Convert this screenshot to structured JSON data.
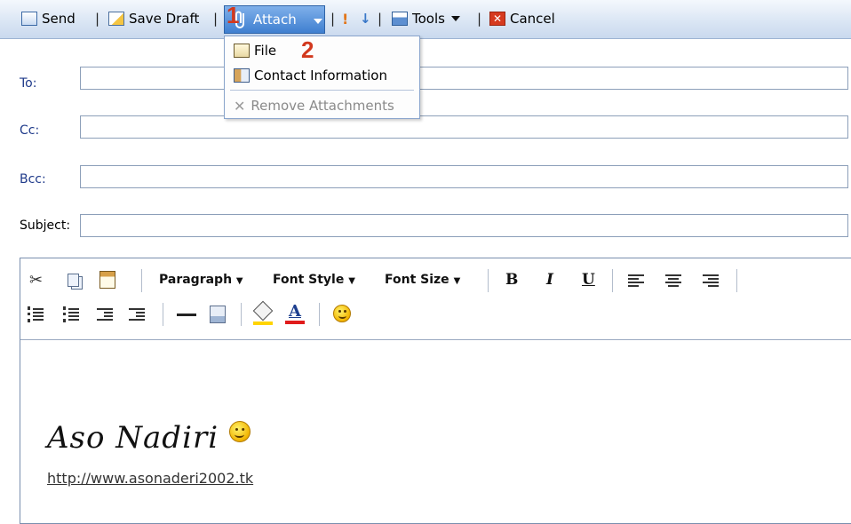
{
  "toolbar": {
    "send": "Send",
    "save_draft": "Save Draft",
    "attach": "Attach",
    "tools": "Tools",
    "cancel": "Cancel",
    "separator": "|",
    "step1": "1",
    "step2": "2"
  },
  "attach_menu": {
    "items": [
      {
        "label": "File",
        "icon": "file-icon",
        "enabled": true
      },
      {
        "label": "Contact Information",
        "icon": "contact-card-icon",
        "enabled": true
      },
      {
        "label": "Remove Attachments",
        "icon": "x-icon",
        "enabled": false
      }
    ]
  },
  "fields": {
    "to_label": "To:",
    "cc_label": "Cc:",
    "bcc_label": "Bcc:",
    "subject_label": "Subject:",
    "to_value": "",
    "cc_value": "",
    "bcc_value": "",
    "subject_value": ""
  },
  "editor": {
    "paragraph": "Paragraph",
    "font_style": "Font Style",
    "font_size": "Font Size",
    "bold": "B",
    "italic": "I",
    "underline": "U",
    "text_color_letter": "A",
    "signature_name": "Aso Nadiri",
    "signature_link": "http://www.asonaderi2002.tk"
  },
  "colors": {
    "toolbar_top": "#f4f8fd",
    "toolbar_bottom": "#c9d9ee",
    "attach_highlight": "#3f7fd0",
    "field_label_blue": "#1f3a8a",
    "step_number": "#d2391e"
  }
}
